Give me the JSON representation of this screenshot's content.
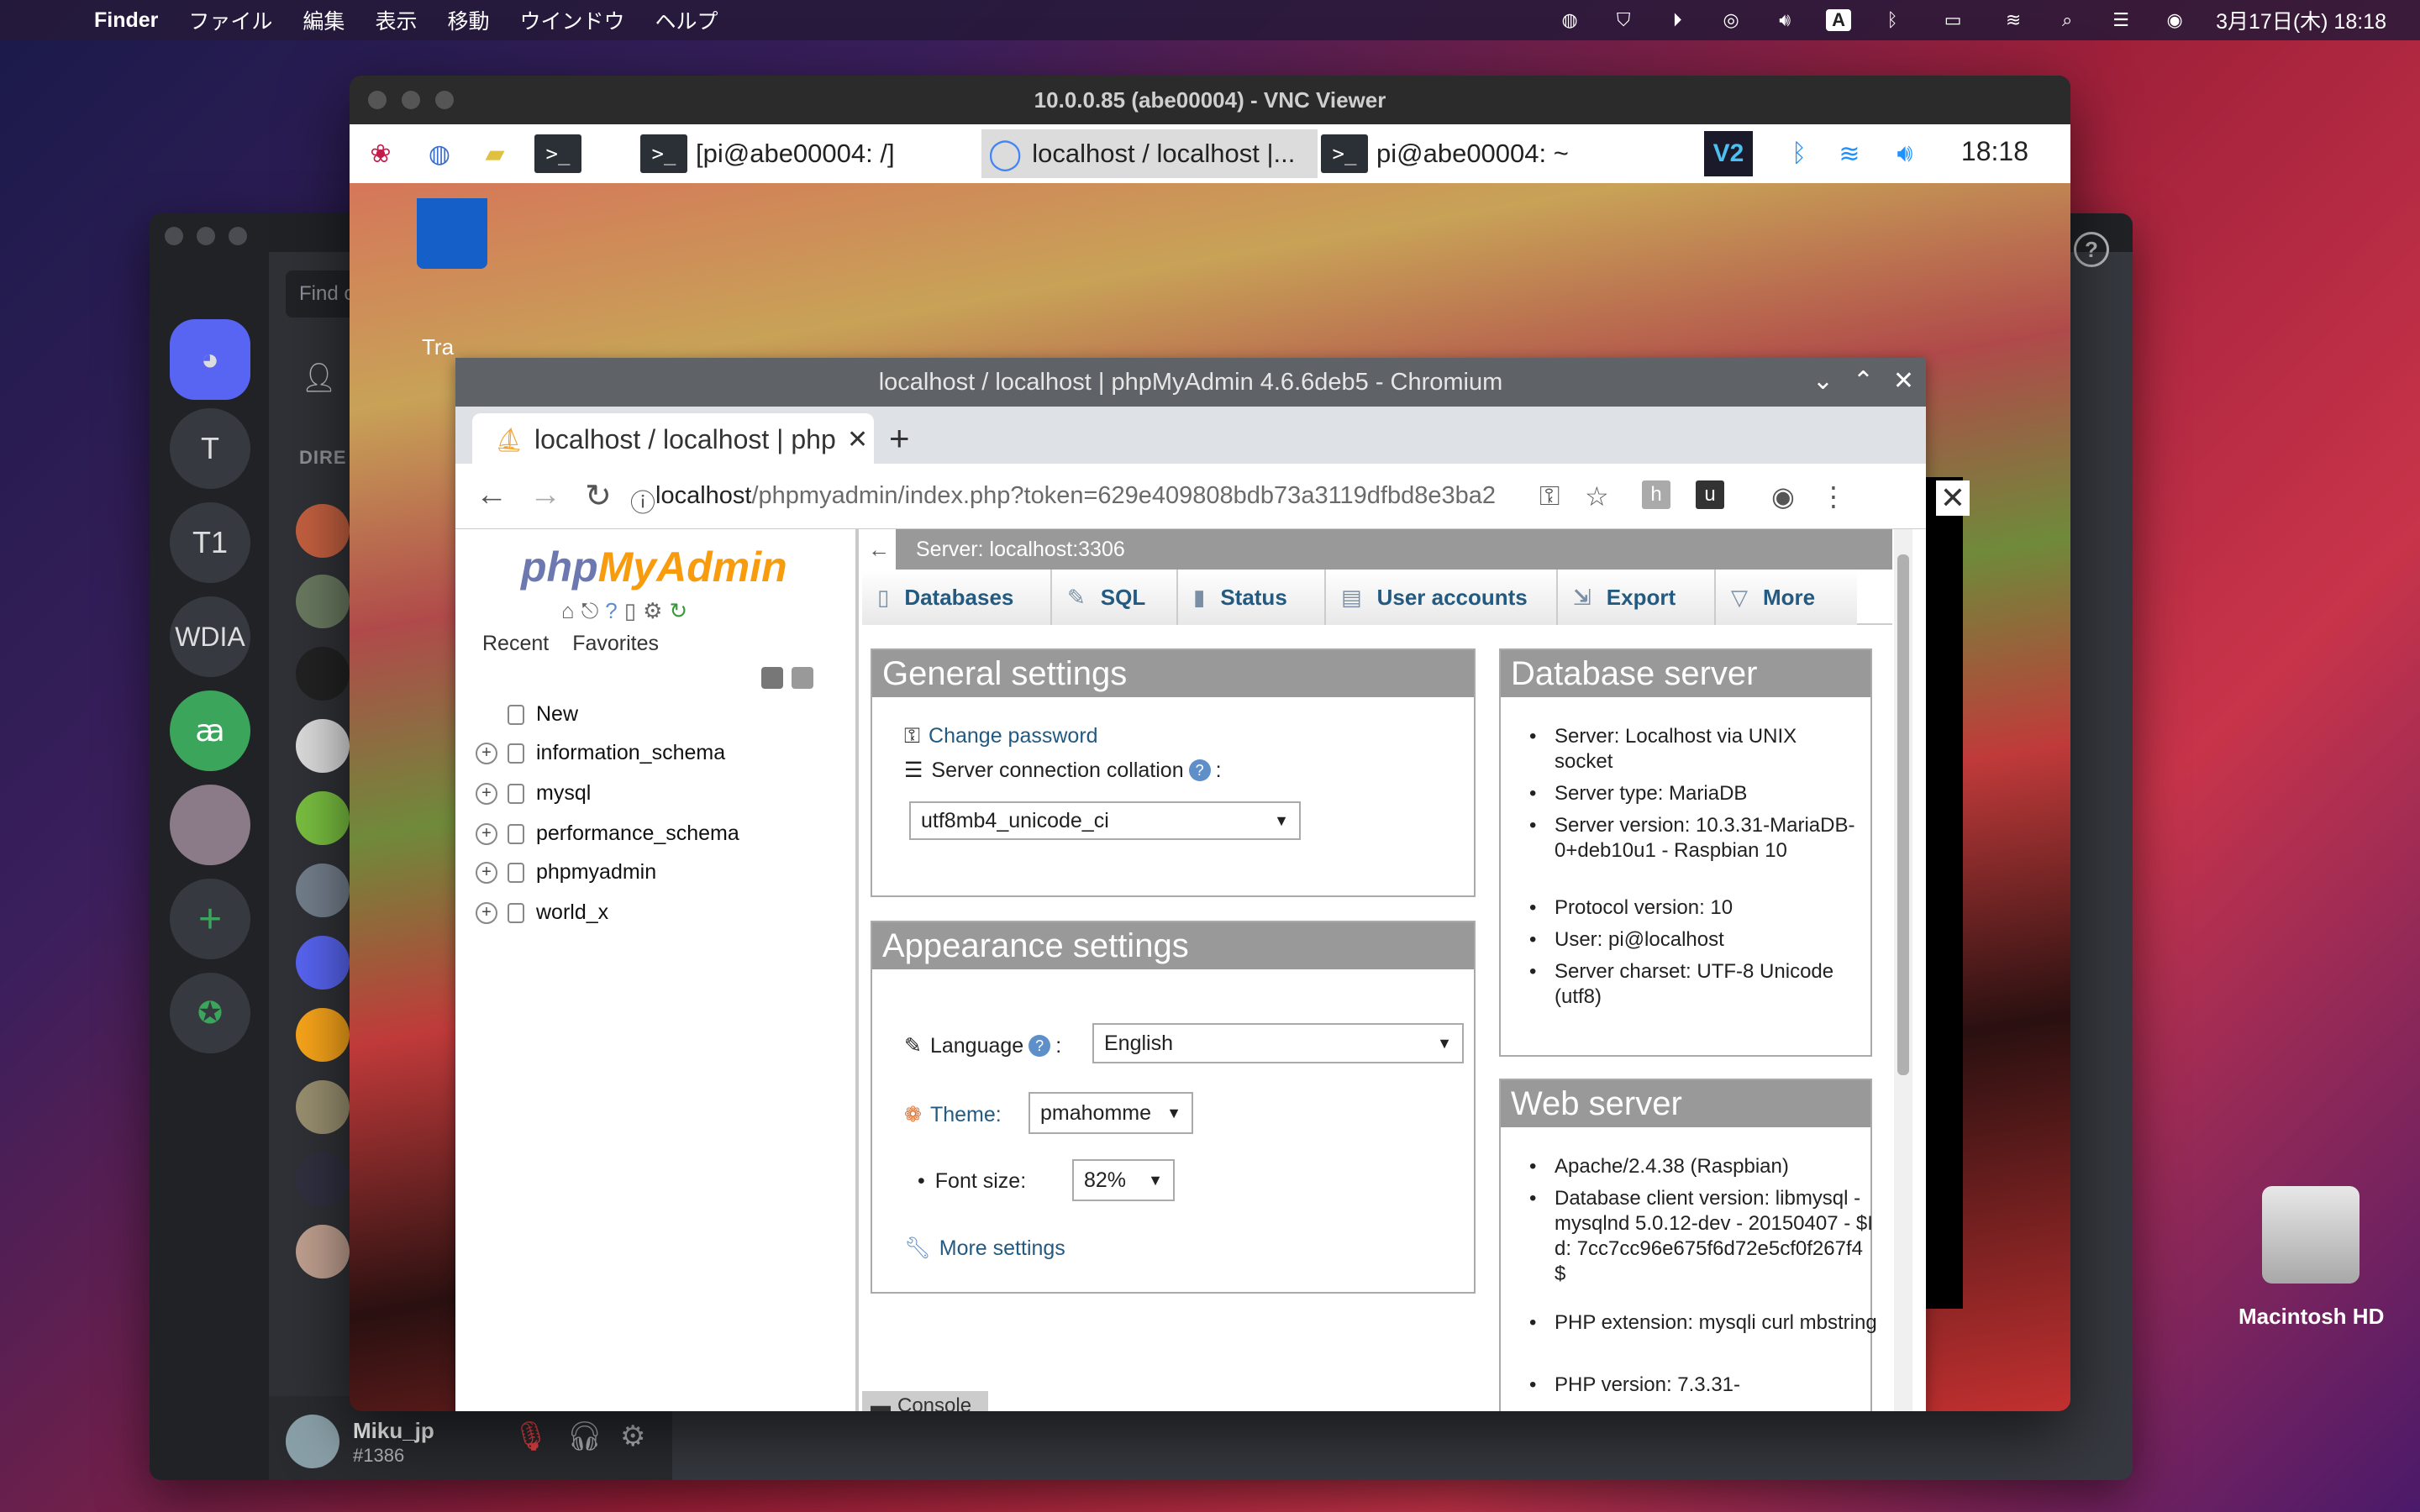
{
  "menubar": {
    "app": "Finder",
    "items": [
      "ファイル",
      "編集",
      "表示",
      "移動",
      "ウインドウ",
      "ヘルプ"
    ],
    "clock": "3月17日(木)  18:18"
  },
  "discord": {
    "find_placeholder": "Find o",
    "direct_label": "DIRE",
    "servers": [
      "T",
      "T1",
      "WDIA"
    ],
    "user": {
      "name": "Miku_jp",
      "tag": "#1386"
    }
  },
  "vnc": {
    "title": "10.0.0.85 (abe00004) - VNC Viewer",
    "taskbar": {
      "buttons": [
        "[pi@abe00004: /]",
        "localhost / localhost |...",
        "pi@abe00004: ~"
      ],
      "time": "18:18"
    },
    "trash_label": "Tra"
  },
  "chromium": {
    "title": "localhost / localhost | phpMyAdmin 4.6.6deb5 - Chromium",
    "tab_label": "localhost / localhost | phpMyAdmin",
    "url_host": "localhost",
    "url_rest": "/phpmyadmin/index.php?token=629e409808bdb73a3119dfbd8e3ba2…"
  },
  "pma": {
    "logo_php": "php",
    "logo_myadmin": "MyAdmin",
    "recent": "Recent",
    "favorites": "Favorites",
    "tree": [
      "New",
      "information_schema",
      "mysql",
      "performance_schema",
      "phpmyadmin",
      "world_x"
    ],
    "server_label": "Server: localhost:3306",
    "tabs": [
      "Databases",
      "SQL",
      "Status",
      "User accounts",
      "Export",
      "More"
    ],
    "general": {
      "title": "General settings",
      "change_password": "Change password",
      "collation_label": "Server connection collation",
      "collation_value": "utf8mb4_unicode_ci"
    },
    "appearance": {
      "title": "Appearance settings",
      "language_label": "Language",
      "language_value": "English",
      "theme_label": "Theme:",
      "theme_value": "pmahomme",
      "fontsize_label": "Font size:",
      "fontsize_value": "82%",
      "more_settings": "More settings"
    },
    "dbserver": {
      "title": "Database server",
      "items": [
        "Server: Localhost via UNIX socket",
        "Server type: MariaDB",
        "Server version: 10.3.31-MariaDB-0+deb10u1 - Raspbian 10",
        "Protocol version: 10",
        "User: pi@localhost",
        "Server charset: UTF-8 Unicode (utf8)"
      ]
    },
    "webserver": {
      "title": "Web server",
      "items": [
        "Apache/2.4.38 (Raspbian)",
        "Database client version: libmysql - mysqlnd 5.0.12-dev - 20150407 - $Id: 7cc7cc96e675f6d72e5cf0f267f4 $",
        "PHP extension: mysqli  curl  mbstring",
        "PHP version: 7.3.31-"
      ]
    },
    "console": "Console"
  },
  "desktop": {
    "hd_label": "Macintosh HD"
  }
}
